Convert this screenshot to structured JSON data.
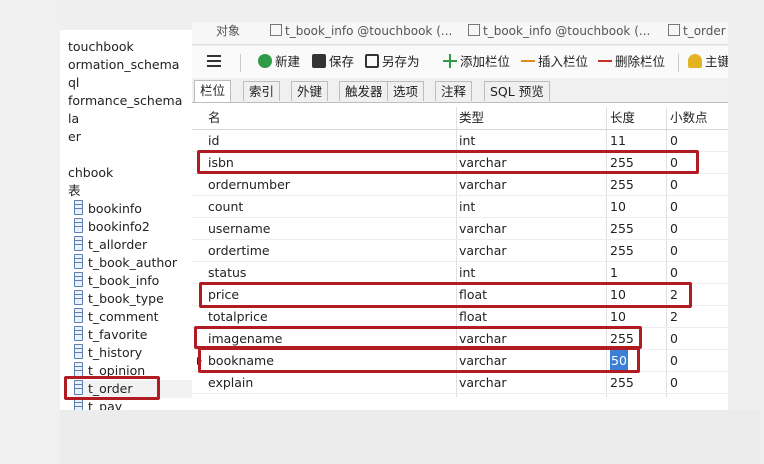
{
  "tabs_bar": {
    "items": [
      "对象",
      "t_book_info @touchbook (...",
      "t_book_info @touchbook (...",
      "t_order"
    ]
  },
  "toolbar": {
    "new_label": "新建",
    "save_label": "保存",
    "save_as_label": "另存为",
    "add_field_label": "添加栏位",
    "insert_field_label": "插入栏位",
    "delete_field_label": "删除栏位",
    "primary_key_label": "主键"
  },
  "subtabs": [
    "栏位",
    "索引",
    "外键",
    "触发器",
    "选项",
    "注释",
    "SQL 预览"
  ],
  "tree": {
    "databases": [
      "touchbook",
      "ormation_schema",
      "ql",
      "formance_schema",
      "la",
      "er",
      "chbook",
      "表"
    ],
    "tables": [
      "bookinfo",
      "bookinfo2",
      "t_allorder",
      "t_book_author",
      "t_book_info",
      "t_book_type",
      "t_comment",
      "t_favorite",
      "t_history",
      "t_opinion",
      "t_order",
      "t_pay"
    ],
    "selected_table": "t_order"
  },
  "grid": {
    "columns": [
      "名",
      "类型",
      "长度",
      "小数点"
    ],
    "rows": [
      {
        "name": "id",
        "type": "int",
        "length": "11",
        "decimals": "0"
      },
      {
        "name": "isbn",
        "type": "varchar",
        "length": "255",
        "decimals": "0"
      },
      {
        "name": "ordernumber",
        "type": "varchar",
        "length": "255",
        "decimals": "0"
      },
      {
        "name": "count",
        "type": "int",
        "length": "10",
        "decimals": "0"
      },
      {
        "name": "username",
        "type": "varchar",
        "length": "255",
        "decimals": "0"
      },
      {
        "name": "ordertime",
        "type": "varchar",
        "length": "255",
        "decimals": "0"
      },
      {
        "name": "status",
        "type": "int",
        "length": "1",
        "decimals": "0"
      },
      {
        "name": "price",
        "type": "float",
        "length": "10",
        "decimals": "2"
      },
      {
        "name": "totalprice",
        "type": "float",
        "length": "10",
        "decimals": "2"
      },
      {
        "name": "imagename",
        "type": "varchar",
        "length": "255",
        "decimals": "0"
      },
      {
        "name": "bookname",
        "type": "varchar",
        "length": "50",
        "decimals": "0"
      },
      {
        "name": "explain",
        "type": "varchar",
        "length": "255",
        "decimals": "0"
      }
    ],
    "current_row": "bookname",
    "selected_value": "50"
  },
  "colors": {
    "highlight_red": "#b01c22",
    "selection_blue": "#3d7fd6"
  }
}
